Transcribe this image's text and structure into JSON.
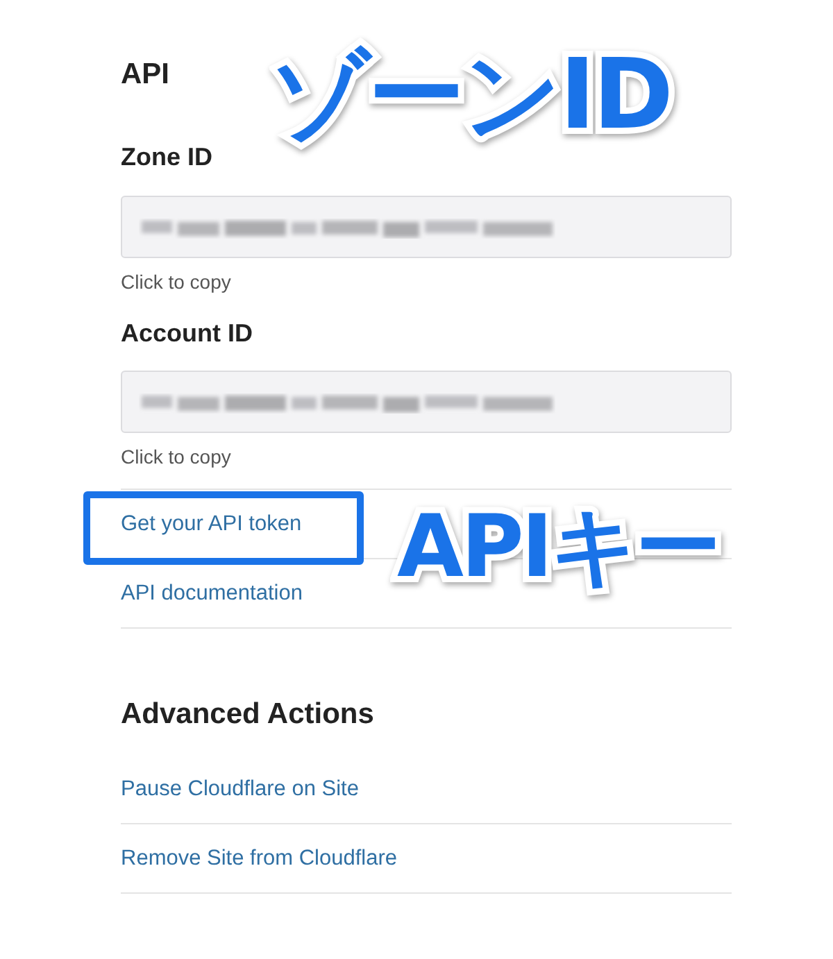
{
  "sections": [
    {
      "title": "API",
      "fields": [
        {
          "label": "Zone ID",
          "value_hidden": true,
          "hint": "Click to copy"
        },
        {
          "label": "Account ID",
          "value_hidden": true,
          "hint": "Click to copy"
        }
      ],
      "links": [
        {
          "label": "Get your API token",
          "highlighted": true
        },
        {
          "label": "API documentation",
          "highlighted": false
        }
      ]
    },
    {
      "title": "Advanced Actions",
      "links": [
        {
          "label": "Pause Cloudflare on Site",
          "highlighted": false
        },
        {
          "label": "Remove Site from Cloudflare",
          "highlighted": false
        }
      ]
    }
  ],
  "annotations": [
    {
      "text": "ゾーンID",
      "kind": "zone"
    },
    {
      "text": "APIキー",
      "kind": "key"
    }
  ]
}
